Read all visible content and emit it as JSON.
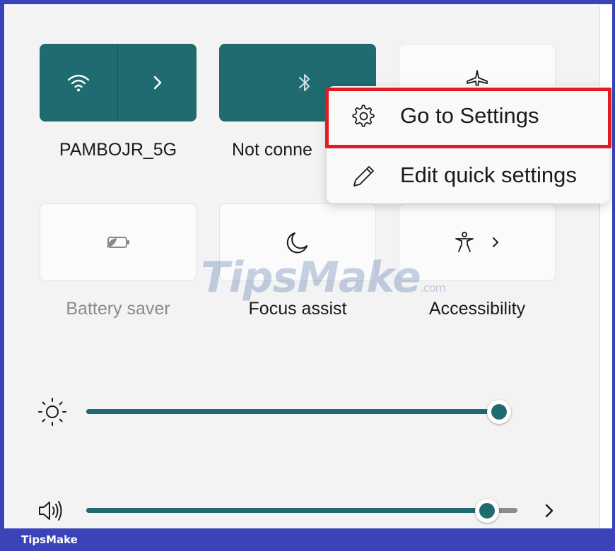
{
  "quick_settings": {
    "wifi": {
      "label": "PAMBOJR_5G",
      "icon": "wifi-icon",
      "expand_icon": "chevron-right-icon",
      "state": "on"
    },
    "bluetooth": {
      "label": "Not conne",
      "icon": "bluetooth-icon",
      "state": "on"
    },
    "airplane": {
      "icon": "airplane-icon",
      "state": "off"
    },
    "battery_saver": {
      "label": "Battery saver",
      "icon": "battery-saver-icon",
      "state": "disabled"
    },
    "focus_assist": {
      "label": "Focus assist",
      "icon": "moon-icon",
      "state": "off"
    },
    "accessibility": {
      "label": "Accessibility",
      "icon": "accessibility-icon",
      "expand_icon": "chevron-right-icon",
      "state": "off"
    }
  },
  "context_menu": {
    "items": [
      {
        "label": "Go to Settings",
        "icon": "gear-icon",
        "highlighted": true
      },
      {
        "label": "Edit quick settings",
        "icon": "pencil-icon",
        "highlighted": false
      }
    ]
  },
  "sliders": {
    "brightness": {
      "icon": "brightness-icon",
      "value_fraction": 0.99
    },
    "volume": {
      "icon": "speaker-icon",
      "value_fraction": 0.93,
      "expand_icon": "chevron-right-icon"
    }
  },
  "watermark": {
    "main": "TipsMake",
    "suffix": ".com"
  },
  "footer": {
    "brand": "TipsMake"
  },
  "colors": {
    "accent": "#1f6b6f",
    "frame": "#3a44b8",
    "highlight": "#e11b22"
  }
}
